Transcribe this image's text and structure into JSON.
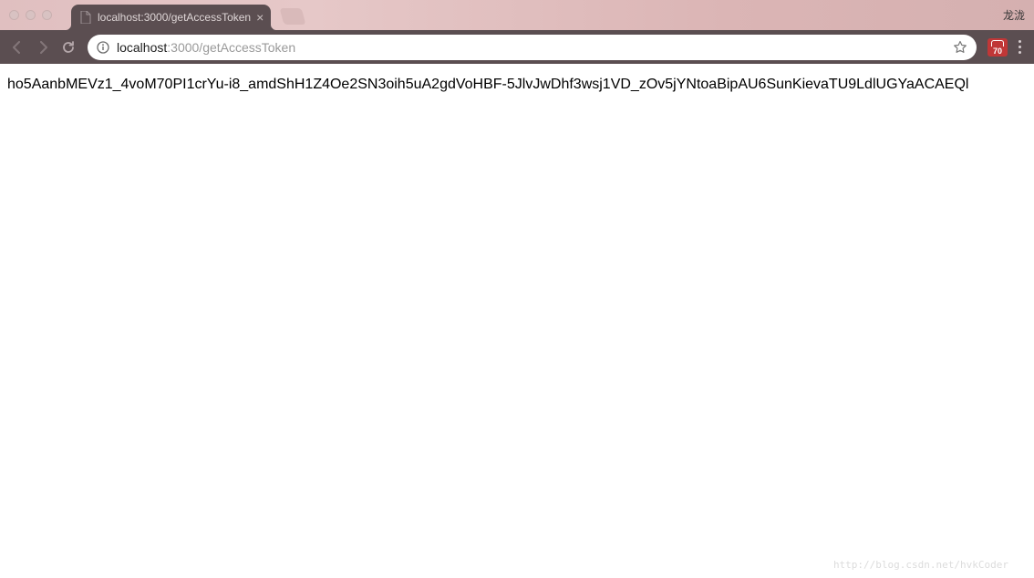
{
  "window": {
    "user_label": "龙泷"
  },
  "tabs": {
    "active": {
      "title": "localhost:3000/getAccessToken"
    }
  },
  "address": {
    "url_host": "localhost",
    "url_path": ":3000/getAccessToken"
  },
  "extension": {
    "badge_count": "70"
  },
  "page": {
    "body_text": "ho5AanbMEVz1_4voM70PI1crYu-i8_amdShH1Z4Oe2SN3oih5uA2gdVoHBF-5JlvJwDhf3wsj1VD_zOv5jYNtoaBipAU6SunKievaTU9LdlUGYaACAEQl"
  },
  "watermark_text": "http://blog.csdn.net/hvkCoder"
}
